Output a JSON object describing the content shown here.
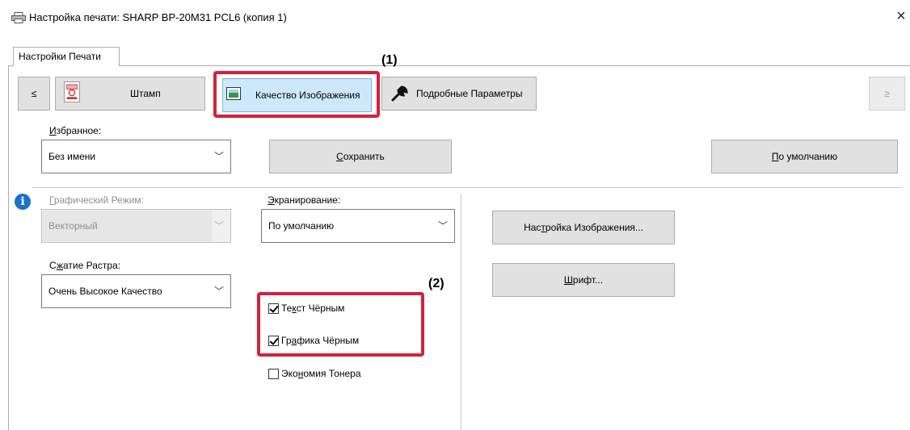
{
  "window": {
    "title": "Настройка печати: SHARP BP-20M31 PCL6 (копия 1)",
    "close_glyph": "×"
  },
  "tabs": [
    {
      "label": "Настройки Печати"
    }
  ],
  "toolbar": {
    "prev_glyph": "≤",
    "next_glyph": "≥",
    "stamp_label": "Штамп",
    "quality_label": "Качество Изображения",
    "detail_label": "Подробные Параметры"
  },
  "annotations": {
    "one": "(1)",
    "two": "(2)"
  },
  "favorites": {
    "label_first": "И",
    "label_rest": "збранное:",
    "value": "Без имени",
    "save_first": "С",
    "save_rest": "охранить",
    "default_first": "П",
    "default_rest": "о умолчанию"
  },
  "graphics_mode": {
    "label_first": "Г",
    "label_rest": "рафический Режим:",
    "value": "Векторный"
  },
  "screening": {
    "label_first": "Э",
    "label_rest": "кранирование:",
    "value": "По умолчанию"
  },
  "image_settings_button": {
    "pre": "Нас",
    "mn": "т",
    "post": "ройка Изображения..."
  },
  "font_button": {
    "mn": "Ш",
    "post": "рифт..."
  },
  "raster": {
    "label_pre": "С",
    "label_mn": "ж",
    "label_post": "атие Растра:",
    "value": "Очень Высокое Качество"
  },
  "checkboxes": {
    "text_black": {
      "pre": "Те",
      "mn": "к",
      "post": "ст Чёрным",
      "checked": true
    },
    "graphics_black": {
      "pre": "Гр",
      "mn": "а",
      "post": "фика Чёрным",
      "checked": true
    },
    "toner_save": {
      "pre": "Эко",
      "mn": "н",
      "post": "омия Тонера",
      "checked": false
    }
  },
  "colors": {
    "highlight_red": "#d4213d",
    "selected_tab_bg": "#cde8fa",
    "info_blue": "#1a73c7"
  },
  "icons": [
    "printer-icon",
    "stamp-icon",
    "image-quality-icon",
    "wrench-icon",
    "info-icon",
    "chevron-down-icon"
  ]
}
